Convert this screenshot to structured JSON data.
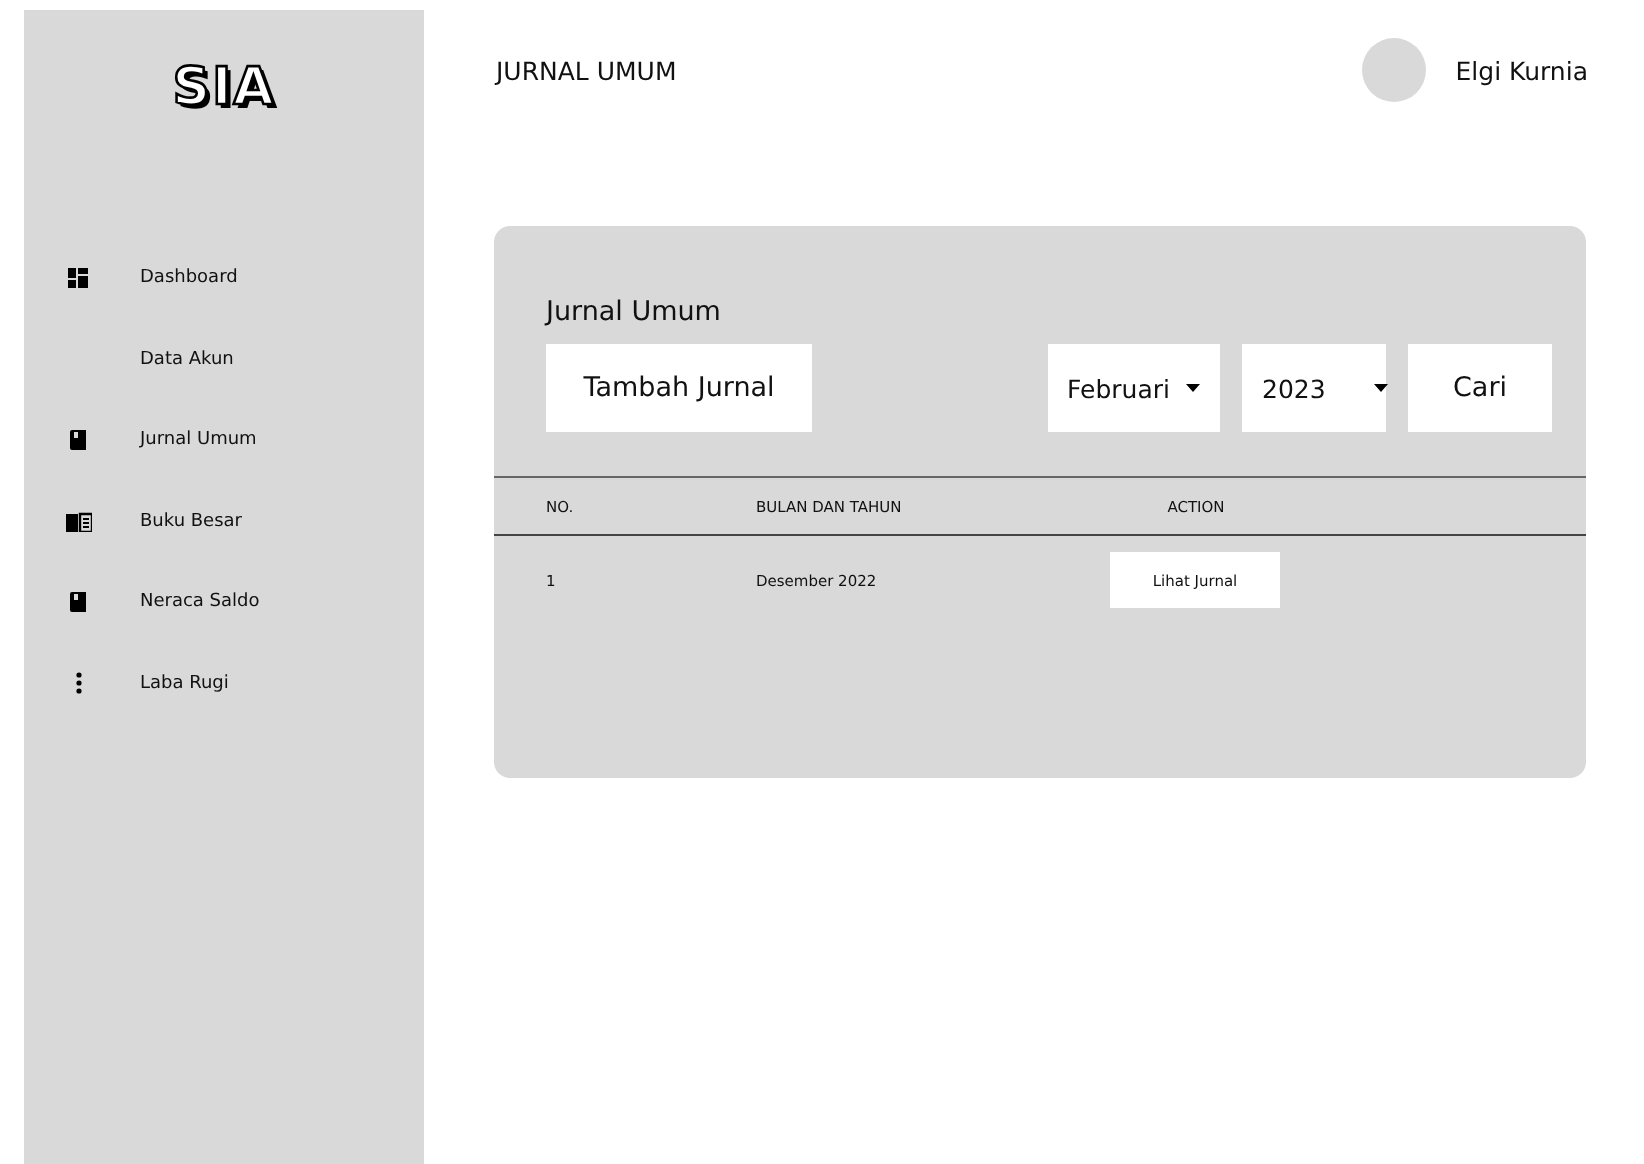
{
  "logo": "SIA",
  "sidebar": {
    "items": [
      {
        "label": "Dashboard"
      },
      {
        "label": "Data Akun"
      },
      {
        "label": "Jurnal Umum"
      },
      {
        "label": "Buku Besar"
      },
      {
        "label": "Neraca Saldo"
      },
      {
        "label": "Laba Rugi"
      }
    ]
  },
  "header": {
    "title": "JURNAL UMUM",
    "user": "Elgi Kurnia"
  },
  "card": {
    "title": "Jurnal Umum",
    "add_button": "Tambah Jurnal",
    "month": "Februari",
    "year": "2023",
    "search_button": "Cari",
    "table": {
      "columns": [
        "NO.",
        "BULAN DAN TAHUN",
        "ACTION"
      ],
      "rows": [
        {
          "no": "1",
          "period": "Desember 2022",
          "action": "Lihat Jurnal"
        }
      ]
    }
  }
}
